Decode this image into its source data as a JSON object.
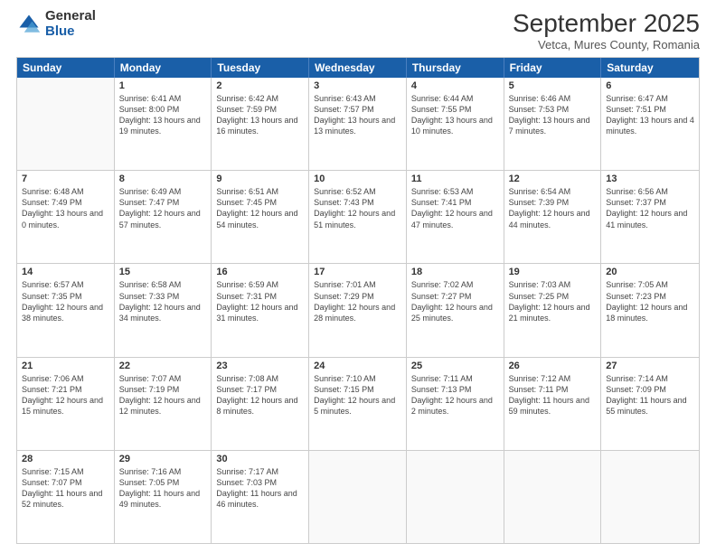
{
  "logo": {
    "general": "General",
    "blue": "Blue"
  },
  "header": {
    "month": "September 2025",
    "location": "Vetca, Mures County, Romania"
  },
  "days_of_week": [
    "Sunday",
    "Monday",
    "Tuesday",
    "Wednesday",
    "Thursday",
    "Friday",
    "Saturday"
  ],
  "weeks": [
    [
      {
        "day": "",
        "empty": true
      },
      {
        "day": "1",
        "sunrise": "Sunrise: 6:41 AM",
        "sunset": "Sunset: 8:00 PM",
        "daylight": "Daylight: 13 hours and 19 minutes."
      },
      {
        "day": "2",
        "sunrise": "Sunrise: 6:42 AM",
        "sunset": "Sunset: 7:59 PM",
        "daylight": "Daylight: 13 hours and 16 minutes."
      },
      {
        "day": "3",
        "sunrise": "Sunrise: 6:43 AM",
        "sunset": "Sunset: 7:57 PM",
        "daylight": "Daylight: 13 hours and 13 minutes."
      },
      {
        "day": "4",
        "sunrise": "Sunrise: 6:44 AM",
        "sunset": "Sunset: 7:55 PM",
        "daylight": "Daylight: 13 hours and 10 minutes."
      },
      {
        "day": "5",
        "sunrise": "Sunrise: 6:46 AM",
        "sunset": "Sunset: 7:53 PM",
        "daylight": "Daylight: 13 hours and 7 minutes."
      },
      {
        "day": "6",
        "sunrise": "Sunrise: 6:47 AM",
        "sunset": "Sunset: 7:51 PM",
        "daylight": "Daylight: 13 hours and 4 minutes."
      }
    ],
    [
      {
        "day": "7",
        "sunrise": "Sunrise: 6:48 AM",
        "sunset": "Sunset: 7:49 PM",
        "daylight": "Daylight: 13 hours and 0 minutes."
      },
      {
        "day": "8",
        "sunrise": "Sunrise: 6:49 AM",
        "sunset": "Sunset: 7:47 PM",
        "daylight": "Daylight: 12 hours and 57 minutes."
      },
      {
        "day": "9",
        "sunrise": "Sunrise: 6:51 AM",
        "sunset": "Sunset: 7:45 PM",
        "daylight": "Daylight: 12 hours and 54 minutes."
      },
      {
        "day": "10",
        "sunrise": "Sunrise: 6:52 AM",
        "sunset": "Sunset: 7:43 PM",
        "daylight": "Daylight: 12 hours and 51 minutes."
      },
      {
        "day": "11",
        "sunrise": "Sunrise: 6:53 AM",
        "sunset": "Sunset: 7:41 PM",
        "daylight": "Daylight: 12 hours and 47 minutes."
      },
      {
        "day": "12",
        "sunrise": "Sunrise: 6:54 AM",
        "sunset": "Sunset: 7:39 PM",
        "daylight": "Daylight: 12 hours and 44 minutes."
      },
      {
        "day": "13",
        "sunrise": "Sunrise: 6:56 AM",
        "sunset": "Sunset: 7:37 PM",
        "daylight": "Daylight: 12 hours and 41 minutes."
      }
    ],
    [
      {
        "day": "14",
        "sunrise": "Sunrise: 6:57 AM",
        "sunset": "Sunset: 7:35 PM",
        "daylight": "Daylight: 12 hours and 38 minutes."
      },
      {
        "day": "15",
        "sunrise": "Sunrise: 6:58 AM",
        "sunset": "Sunset: 7:33 PM",
        "daylight": "Daylight: 12 hours and 34 minutes."
      },
      {
        "day": "16",
        "sunrise": "Sunrise: 6:59 AM",
        "sunset": "Sunset: 7:31 PM",
        "daylight": "Daylight: 12 hours and 31 minutes."
      },
      {
        "day": "17",
        "sunrise": "Sunrise: 7:01 AM",
        "sunset": "Sunset: 7:29 PM",
        "daylight": "Daylight: 12 hours and 28 minutes."
      },
      {
        "day": "18",
        "sunrise": "Sunrise: 7:02 AM",
        "sunset": "Sunset: 7:27 PM",
        "daylight": "Daylight: 12 hours and 25 minutes."
      },
      {
        "day": "19",
        "sunrise": "Sunrise: 7:03 AM",
        "sunset": "Sunset: 7:25 PM",
        "daylight": "Daylight: 12 hours and 21 minutes."
      },
      {
        "day": "20",
        "sunrise": "Sunrise: 7:05 AM",
        "sunset": "Sunset: 7:23 PM",
        "daylight": "Daylight: 12 hours and 18 minutes."
      }
    ],
    [
      {
        "day": "21",
        "sunrise": "Sunrise: 7:06 AM",
        "sunset": "Sunset: 7:21 PM",
        "daylight": "Daylight: 12 hours and 15 minutes."
      },
      {
        "day": "22",
        "sunrise": "Sunrise: 7:07 AM",
        "sunset": "Sunset: 7:19 PM",
        "daylight": "Daylight: 12 hours and 12 minutes."
      },
      {
        "day": "23",
        "sunrise": "Sunrise: 7:08 AM",
        "sunset": "Sunset: 7:17 PM",
        "daylight": "Daylight: 12 hours and 8 minutes."
      },
      {
        "day": "24",
        "sunrise": "Sunrise: 7:10 AM",
        "sunset": "Sunset: 7:15 PM",
        "daylight": "Daylight: 12 hours and 5 minutes."
      },
      {
        "day": "25",
        "sunrise": "Sunrise: 7:11 AM",
        "sunset": "Sunset: 7:13 PM",
        "daylight": "Daylight: 12 hours and 2 minutes."
      },
      {
        "day": "26",
        "sunrise": "Sunrise: 7:12 AM",
        "sunset": "Sunset: 7:11 PM",
        "daylight": "Daylight: 11 hours and 59 minutes."
      },
      {
        "day": "27",
        "sunrise": "Sunrise: 7:14 AM",
        "sunset": "Sunset: 7:09 PM",
        "daylight": "Daylight: 11 hours and 55 minutes."
      }
    ],
    [
      {
        "day": "28",
        "sunrise": "Sunrise: 7:15 AM",
        "sunset": "Sunset: 7:07 PM",
        "daylight": "Daylight: 11 hours and 52 minutes."
      },
      {
        "day": "29",
        "sunrise": "Sunrise: 7:16 AM",
        "sunset": "Sunset: 7:05 PM",
        "daylight": "Daylight: 11 hours and 49 minutes."
      },
      {
        "day": "30",
        "sunrise": "Sunrise: 7:17 AM",
        "sunset": "Sunset: 7:03 PM",
        "daylight": "Daylight: 11 hours and 46 minutes."
      },
      {
        "day": "",
        "empty": true
      },
      {
        "day": "",
        "empty": true
      },
      {
        "day": "",
        "empty": true
      },
      {
        "day": "",
        "empty": true
      }
    ]
  ]
}
